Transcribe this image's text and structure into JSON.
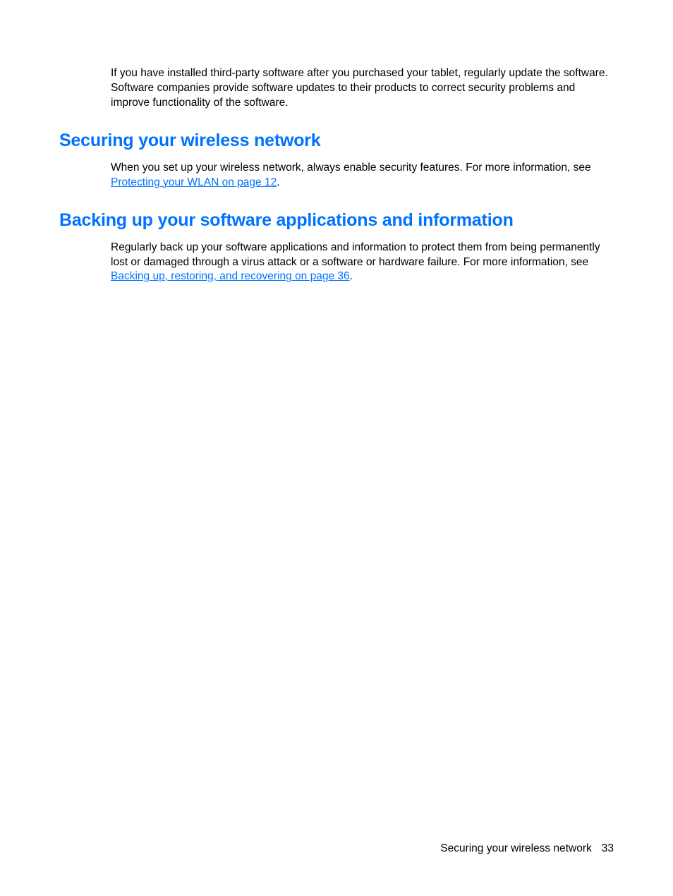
{
  "intro_paragraph": "If you have installed third-party software after you purchased your tablet, regularly update the software. Software companies provide software updates to their products to correct security problems and improve functionality of the software.",
  "section1": {
    "heading": "Securing your wireless network",
    "para_before_link": "When you set up your wireless network, always enable security features. For more information, see ",
    "link_text": "Protecting your WLAN on page 12",
    "para_after_link": "."
  },
  "section2": {
    "heading": "Backing up your software applications and information",
    "para_before_link": "Regularly back up your software applications and information to protect them from being permanently lost or damaged through a virus attack or a software or hardware failure. For more information, see ",
    "link_text": "Backing up, restoring, and recovering on page 36",
    "para_after_link": "."
  },
  "footer": {
    "title": "Securing your wireless network",
    "page_number": "33"
  }
}
